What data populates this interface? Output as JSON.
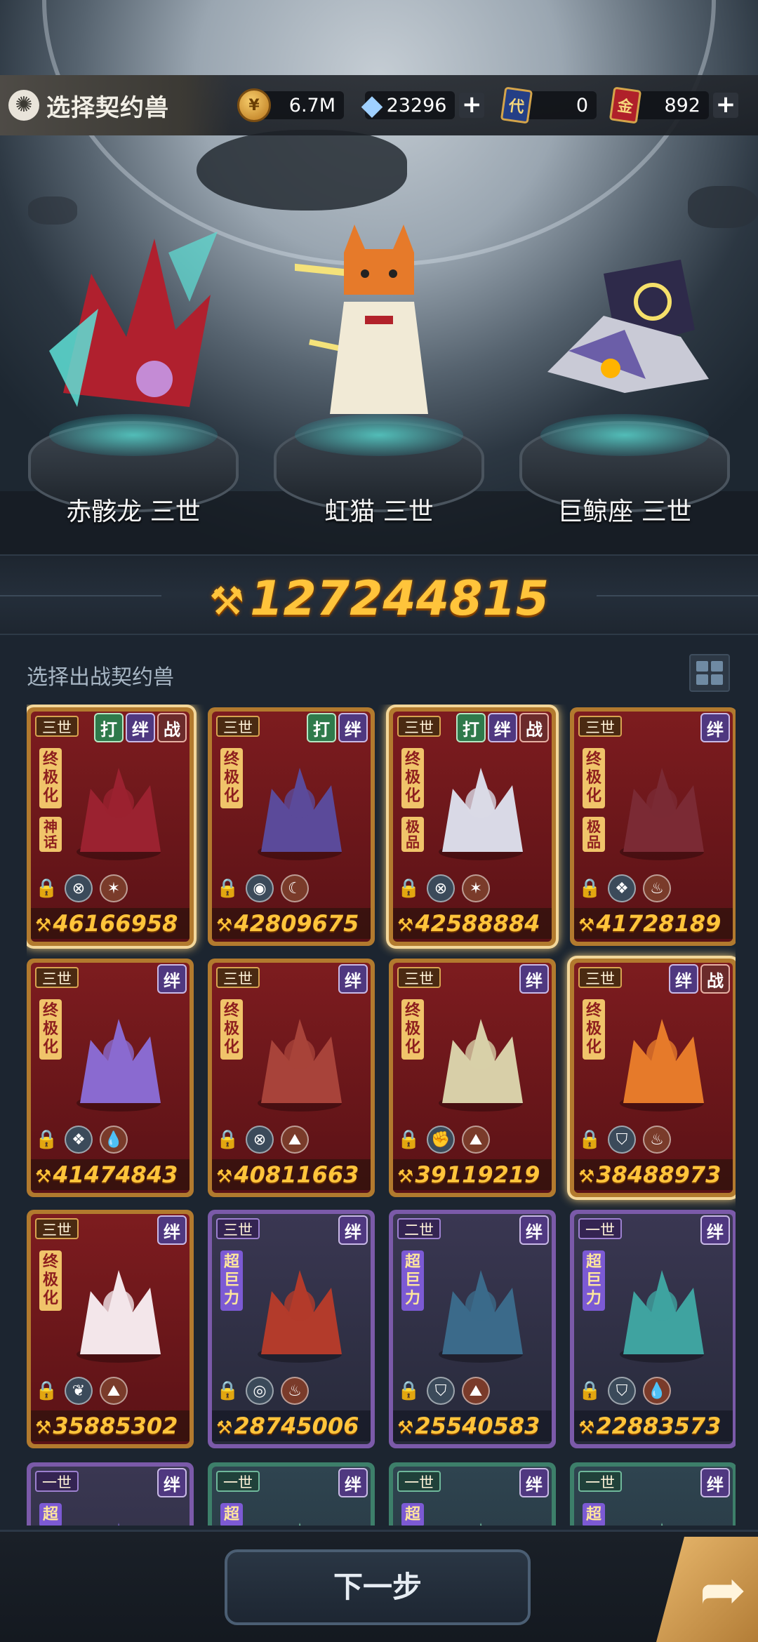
{
  "header": {
    "title": "选择契约兽",
    "resources": [
      {
        "icon": "coin-icon",
        "value": "6.7M",
        "has_plus": false
      },
      {
        "icon": "crystal-icon",
        "value": "23296",
        "has_plus": true
      },
      {
        "icon": "dai-card-icon",
        "glyph": "代",
        "value": "0",
        "has_plus": false
      },
      {
        "icon": "gold-card-icon",
        "glyph": "金",
        "value": "892",
        "has_plus": true
      }
    ]
  },
  "team": [
    {
      "name": "赤骸龙 三世"
    },
    {
      "name": "虹猫 三世"
    },
    {
      "name": "巨鲸座 三世"
    }
  ],
  "total_power": "127244815",
  "list": {
    "title": "选择出战契约兽",
    "cards": [
      {
        "tier": "三世",
        "tags": [
          "打",
          "绊",
          "战"
        ],
        "evo": "终极化",
        "sub": "神话",
        "elements": [
          "⊗",
          "✶"
        ],
        "power": "46166958",
        "frame": "gold",
        "selected": true
      },
      {
        "tier": "三世",
        "tags": [
          "打",
          "绊"
        ],
        "evo": "终极化",
        "sub": "",
        "elements": [
          "◉",
          "☾"
        ],
        "power": "42809675",
        "frame": "gold",
        "selected": false
      },
      {
        "tier": "三世",
        "tags": [
          "打",
          "绊",
          "战"
        ],
        "evo": "终极化",
        "sub": "极品",
        "elements": [
          "⊗",
          "✶"
        ],
        "power": "42588884",
        "frame": "gold",
        "selected": true
      },
      {
        "tier": "三世",
        "tags": [
          "绊"
        ],
        "evo": "终极化",
        "sub": "极品",
        "elements": [
          "❖",
          "♨"
        ],
        "power": "41728189",
        "frame": "gold",
        "selected": false
      },
      {
        "tier": "三世",
        "tags": [
          "绊"
        ],
        "evo": "终极化",
        "sub": "",
        "elements": [
          "❖",
          "💧"
        ],
        "power": "41474843",
        "frame": "gold",
        "selected": false
      },
      {
        "tier": "三世",
        "tags": [
          "绊"
        ],
        "evo": "终极化",
        "sub": "",
        "elements": [
          "⊗",
          "⛰"
        ],
        "power": "40811663",
        "frame": "gold",
        "selected": false
      },
      {
        "tier": "三世",
        "tags": [
          "绊"
        ],
        "evo": "终极化",
        "sub": "",
        "elements": [
          "✊",
          "⛰"
        ],
        "power": "39119219",
        "frame": "gold",
        "selected": false
      },
      {
        "tier": "三世",
        "tags": [
          "绊",
          "战"
        ],
        "evo": "终极化",
        "sub": "",
        "elements": [
          "⛉",
          "♨"
        ],
        "power": "38488973",
        "frame": "gold",
        "selected": true
      },
      {
        "tier": "三世",
        "tags": [
          "绊"
        ],
        "evo": "终极化",
        "sub": "",
        "elements": [
          "❦",
          "⛰"
        ],
        "power": "35885302",
        "frame": "gold",
        "selected": false
      },
      {
        "tier": "三世",
        "tags": [
          "绊"
        ],
        "evo": "超巨力",
        "sub": "",
        "elements": [
          "◎",
          "♨"
        ],
        "power": "28745006",
        "frame": "purple",
        "selected": false
      },
      {
        "tier": "二世",
        "tags": [
          "绊"
        ],
        "evo": "超巨力",
        "sub": "",
        "elements": [
          "⛉",
          "⛰"
        ],
        "power": "25540583",
        "frame": "purple",
        "selected": false
      },
      {
        "tier": "一世",
        "tags": [
          "绊"
        ],
        "evo": "超巨力",
        "sub": "",
        "elements": [
          "⛉",
          "💧"
        ],
        "power": "22883573",
        "frame": "purple",
        "selected": false
      },
      {
        "tier": "一世",
        "tags": [
          "绊"
        ],
        "evo": "超",
        "sub": "",
        "elements": [],
        "power": "",
        "frame": "purple",
        "selected": false
      },
      {
        "tier": "一世",
        "tags": [
          "绊"
        ],
        "evo": "超",
        "sub": "",
        "elements": [],
        "power": "",
        "frame": "green",
        "selected": false
      },
      {
        "tier": "一世",
        "tags": [
          "绊"
        ],
        "evo": "超",
        "sub": "",
        "elements": [],
        "power": "",
        "frame": "green",
        "selected": false
      },
      {
        "tier": "一世",
        "tags": [
          "绊"
        ],
        "evo": "超",
        "sub": "",
        "elements": [],
        "power": "",
        "frame": "green",
        "selected": false
      }
    ]
  },
  "footer": {
    "next_label": "下一步",
    "action_icon": "arrow-icon"
  },
  "colors": {
    "accent": "#ffc43b",
    "card_red": "#7d1c1f",
    "gold_frame": "#b27a2e",
    "purple_frame": "#7b5aa9"
  }
}
